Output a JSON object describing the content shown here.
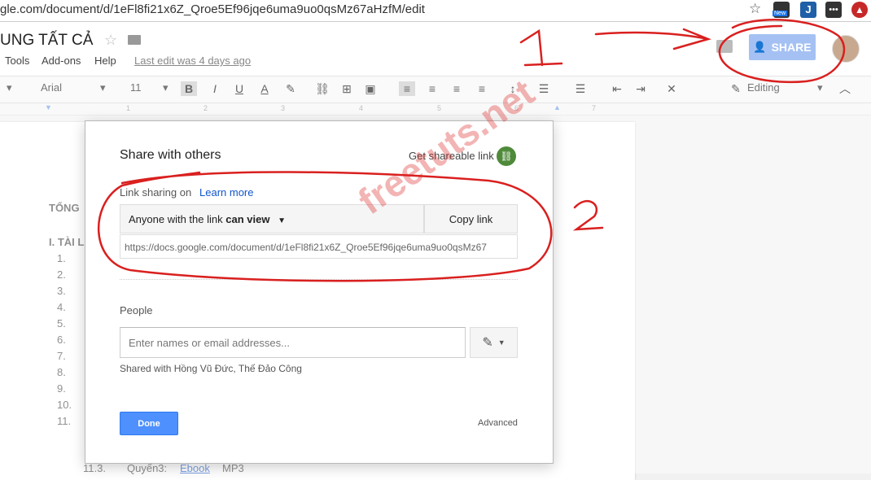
{
  "browser": {
    "url": "gle.com/document/d/1eFl8fi21x6Z_Qroe5Ef96jqe6uma9uo0qsMz67aHzfM/edit",
    "extension_badge": "New"
  },
  "doc": {
    "title": "UNG TẤT CẢ",
    "menus": [
      "Tools",
      "Add-ons",
      "Help"
    ],
    "last_edit": "Last edit was 4 days ago",
    "share_label": "SHARE"
  },
  "toolbar": {
    "font": "Arial",
    "size": "11",
    "mode": "Editing"
  },
  "ruler": {
    "ticks": [
      "1",
      "2",
      "3",
      "4",
      "5",
      "6",
      "7"
    ]
  },
  "page": {
    "heading": "TỔNG",
    "section": "I. TÀI L",
    "numbers": [
      "1.",
      "2.",
      "3.",
      "4.",
      "5.",
      "6.",
      "7.",
      "8.",
      "9.",
      "10.",
      "11."
    ],
    "bottom_row": {
      "num": "11.3.",
      "label": "Quyển3:",
      "link": "Ebook",
      "suffix": "MP3"
    }
  },
  "dialog": {
    "title": "Share with others",
    "get_link": "Get shareable link",
    "sharing_on": "Link sharing on",
    "learn_more": "Learn more",
    "permission_prefix": "Anyone with the link",
    "permission_bold": "can view",
    "copy_link": "Copy link",
    "url": "https://docs.google.com/document/d/1eFl8fi21x6Z_Qroe5Ef96jqe6uma9uo0qsMz67",
    "people_label": "People",
    "people_placeholder": "Enter names or email addresses...",
    "shared_with": "Shared with Hồng Vũ Đức, Thế Đảo Công",
    "done": "Done",
    "advanced": "Advanced"
  },
  "watermark": "freetuts.net",
  "annotations": {
    "step1": "1",
    "step2": "2",
    "color": "#d9201f"
  }
}
